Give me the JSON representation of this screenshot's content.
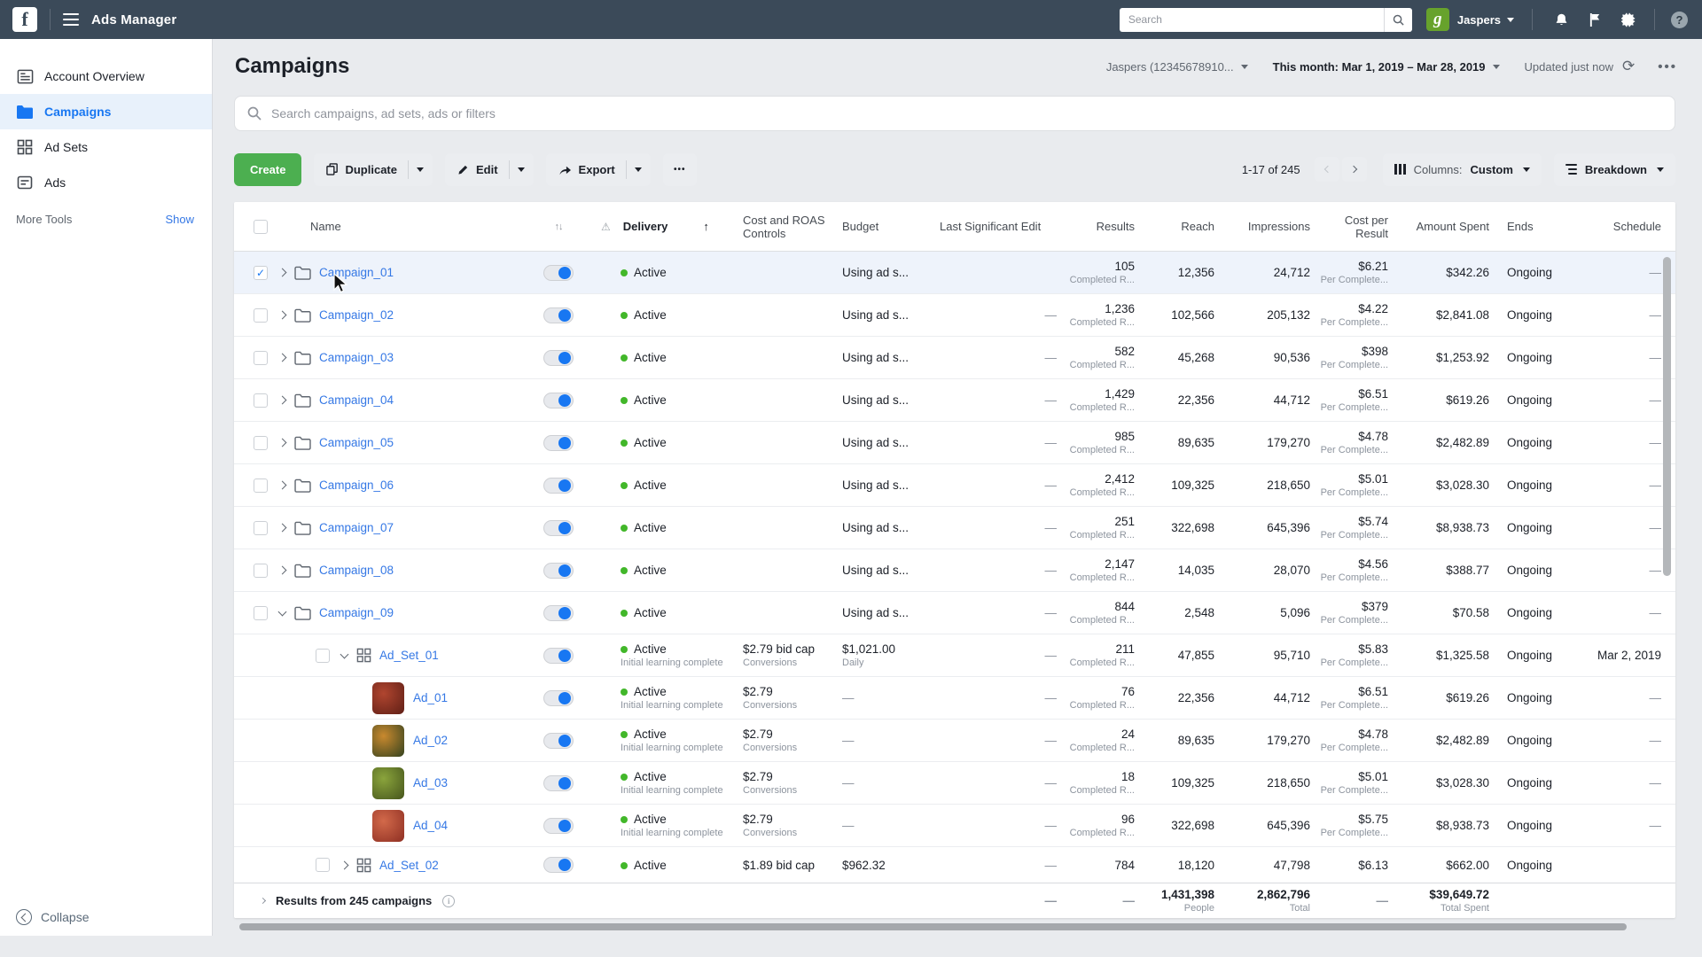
{
  "colors": {
    "topbar_bg": "#3b4a59",
    "accent_blue": "#1877f2",
    "link_blue": "#3578e5",
    "active_green": "#42b72a",
    "create_green": "#4caf50",
    "selected_row": "#eef3fb",
    "avatar_green": "#67a22c"
  },
  "topbar": {
    "logo_letter": "f",
    "title": "Ads Manager",
    "search_placeholder": "Search",
    "avatar_letter": "g",
    "user": "Jaspers",
    "help": "?"
  },
  "sidebar": {
    "items": [
      {
        "label": "Account Overview",
        "icon": "account-overview-icon",
        "selected": false
      },
      {
        "label": "Campaigns",
        "icon": "campaigns-folder-icon",
        "selected": true
      },
      {
        "label": "Ad Sets",
        "icon": "ad-sets-grid-icon",
        "selected": false
      },
      {
        "label": "Ads",
        "icon": "ads-icon",
        "selected": false
      }
    ],
    "more_tools": "More Tools",
    "show": "Show",
    "collapse": "Collapse"
  },
  "header": {
    "title": "Campaigns",
    "account": "Jaspers (12345678910...",
    "date_range": "This month: Mar 1, 2019 – Mar 28, 2019",
    "updated": "Updated just now",
    "refresh_icon": "⟳",
    "more": "•••"
  },
  "search": {
    "placeholder": "Search campaigns, ad sets, ads or filters"
  },
  "toolbar": {
    "create": "Create",
    "duplicate": "Duplicate",
    "edit": "Edit",
    "export": "Export",
    "more": "•••",
    "range": "1-17 of 245",
    "columns_prefix": "Columns:",
    "columns_value": "Custom",
    "breakdown": "Breakdown"
  },
  "table": {
    "columns": {
      "name": "Name",
      "sort": "↑↓",
      "warn": "⚠",
      "delivery": "Delivery",
      "delivery_sort": "↑",
      "cost_roas": "Cost and ROAS Controls",
      "budget": "Budget",
      "last_edit": "Last Significant Edit",
      "results": "Results",
      "reach": "Reach",
      "impressions": "Impressions",
      "cpr": "Cost per Result",
      "spent": "Amount Spent",
      "ends": "Ends",
      "schedule": "Schedule"
    },
    "rows": [
      {
        "type": "campaign",
        "name": "Campaign_01",
        "chevron": "right",
        "checked": true,
        "selected": true,
        "delivery": "Active",
        "delivery_sub": "",
        "cost_roas": "",
        "cost_roas_sub": "",
        "budget": "Using ad s...",
        "budget_sub": "",
        "last_edit": "",
        "results": "105",
        "results_sub": "Completed R...",
        "reach": "12,356",
        "impressions": "24,712",
        "cpr": "$6.21",
        "cpr_sub": "Per Complete...",
        "spent": "$342.26",
        "ends": "Ongoing",
        "schedule": "—"
      },
      {
        "type": "campaign",
        "name": "Campaign_02",
        "chevron": "right",
        "checked": false,
        "selected": false,
        "delivery": "Active",
        "delivery_sub": "",
        "cost_roas": "",
        "cost_roas_sub": "",
        "budget": "Using ad s...",
        "budget_sub": "",
        "last_edit": "—",
        "results": "1,236",
        "results_sub": "Completed R...",
        "reach": "102,566",
        "impressions": "205,132",
        "cpr": "$4.22",
        "cpr_sub": "Per Complete...",
        "spent": "$2,841.08",
        "ends": "Ongoing",
        "schedule": "—"
      },
      {
        "type": "campaign",
        "name": "Campaign_03",
        "chevron": "right",
        "checked": false,
        "selected": false,
        "delivery": "Active",
        "delivery_sub": "",
        "cost_roas": "",
        "cost_roas_sub": "",
        "budget": "Using ad s...",
        "budget_sub": "",
        "last_edit": "—",
        "results": "582",
        "results_sub": "Completed R...",
        "reach": "45,268",
        "impressions": "90,536",
        "cpr": "$398",
        "cpr_sub": "Per Complete...",
        "spent": "$1,253.92",
        "ends": "Ongoing",
        "schedule": "—"
      },
      {
        "type": "campaign",
        "name": "Campaign_04",
        "chevron": "right",
        "checked": false,
        "selected": false,
        "delivery": "Active",
        "delivery_sub": "",
        "cost_roas": "",
        "cost_roas_sub": "",
        "budget": "Using ad s...",
        "budget_sub": "",
        "last_edit": "—",
        "results": "1,429",
        "results_sub": "Completed R...",
        "reach": "22,356",
        "impressions": "44,712",
        "cpr": "$6.51",
        "cpr_sub": "Per Complete...",
        "spent": "$619.26",
        "ends": "Ongoing",
        "schedule": "—"
      },
      {
        "type": "campaign",
        "name": "Campaign_05",
        "chevron": "right",
        "checked": false,
        "selected": false,
        "delivery": "Active",
        "delivery_sub": "",
        "cost_roas": "",
        "cost_roas_sub": "",
        "budget": "Using ad s...",
        "budget_sub": "",
        "last_edit": "—",
        "results": "985",
        "results_sub": "Completed R...",
        "reach": "89,635",
        "impressions": "179,270",
        "cpr": "$4.78",
        "cpr_sub": "Per Complete...",
        "spent": "$2,482.89",
        "ends": "Ongoing",
        "schedule": "—"
      },
      {
        "type": "campaign",
        "name": "Campaign_06",
        "chevron": "right",
        "checked": false,
        "selected": false,
        "delivery": "Active",
        "delivery_sub": "",
        "cost_roas": "",
        "cost_roas_sub": "",
        "budget": "Using ad s...",
        "budget_sub": "",
        "last_edit": "—",
        "results": "2,412",
        "results_sub": "Completed R...",
        "reach": "109,325",
        "impressions": "218,650",
        "cpr": "$5.01",
        "cpr_sub": "Per Complete...",
        "spent": "$3,028.30",
        "ends": "Ongoing",
        "schedule": "—"
      },
      {
        "type": "campaign",
        "name": "Campaign_07",
        "chevron": "right",
        "checked": false,
        "selected": false,
        "delivery": "Active",
        "delivery_sub": "",
        "cost_roas": "",
        "cost_roas_sub": "",
        "budget": "Using ad s...",
        "budget_sub": "",
        "last_edit": "—",
        "results": "251",
        "results_sub": "Completed R...",
        "reach": "322,698",
        "impressions": "645,396",
        "cpr": "$5.74",
        "cpr_sub": "Per Complete...",
        "spent": "$8,938.73",
        "ends": "Ongoing",
        "schedule": "—"
      },
      {
        "type": "campaign",
        "name": "Campaign_08",
        "chevron": "right",
        "checked": false,
        "selected": false,
        "delivery": "Active",
        "delivery_sub": "",
        "cost_roas": "",
        "cost_roas_sub": "",
        "budget": "Using ad s...",
        "budget_sub": "",
        "last_edit": "—",
        "results": "2,147",
        "results_sub": "Completed R...",
        "reach": "14,035",
        "impressions": "28,070",
        "cpr": "$4.56",
        "cpr_sub": "Per Complete...",
        "spent": "$388.77",
        "ends": "Ongoing",
        "schedule": "—"
      },
      {
        "type": "campaign",
        "name": "Campaign_09",
        "chevron": "down",
        "checked": false,
        "selected": false,
        "delivery": "Active",
        "delivery_sub": "",
        "cost_roas": "",
        "cost_roas_sub": "",
        "budget": "Using ad s...",
        "budget_sub": "",
        "last_edit": "—",
        "results": "844",
        "results_sub": "Completed R...",
        "reach": "2,548",
        "impressions": "5,096",
        "cpr": "$379",
        "cpr_sub": "Per Complete...",
        "spent": "$70.58",
        "ends": "Ongoing",
        "schedule": "—"
      },
      {
        "type": "adset",
        "name": "Ad_Set_01",
        "chevron": "down",
        "checked": false,
        "selected": false,
        "delivery": "Active",
        "delivery_sub": "Initial learning complete",
        "cost_roas": "$2.79 bid cap",
        "cost_roas_sub": "Conversions",
        "budget": "$1,021.00",
        "budget_sub": "Daily",
        "last_edit": "—",
        "results": "211",
        "results_sub": "Completed R...",
        "reach": "47,855",
        "impressions": "95,710",
        "cpr": "$5.83",
        "cpr_sub": "Per Complete...",
        "spent": "$1,325.58",
        "ends": "Ongoing",
        "schedule": "Mar 2, 2019"
      },
      {
        "type": "ad",
        "name": "Ad_01",
        "thumb": [
          "#b0452f",
          "#5f1f16"
        ],
        "delivery": "Active",
        "delivery_sub": "Initial learning complete",
        "cost_roas": "$2.79",
        "cost_roas_sub": "Conversions",
        "budget": "—",
        "budget_sub": "",
        "last_edit": "—",
        "results": "76",
        "results_sub": "Completed R...",
        "reach": "22,356",
        "impressions": "44,712",
        "cpr": "$6.51",
        "cpr_sub": "Per Complete...",
        "spent": "$619.26",
        "ends": "Ongoing",
        "schedule": "—"
      },
      {
        "type": "ad",
        "name": "Ad_02",
        "thumb": [
          "#c9892e",
          "#33421f"
        ],
        "delivery": "Active",
        "delivery_sub": "Initial learning complete",
        "cost_roas": "$2.79",
        "cost_roas_sub": "Conversions",
        "budget": "—",
        "budget_sub": "",
        "last_edit": "—",
        "results": "24",
        "results_sub": "Completed R...",
        "reach": "89,635",
        "impressions": "179,270",
        "cpr": "$4.78",
        "cpr_sub": "Per Complete...",
        "spent": "$2,482.89",
        "ends": "Ongoing",
        "schedule": "—"
      },
      {
        "type": "ad",
        "name": "Ad_03",
        "thumb": [
          "#8aa43c",
          "#46551c"
        ],
        "delivery": "Active",
        "delivery_sub": "Initial learning complete",
        "cost_roas": "$2.79",
        "cost_roas_sub": "Conversions",
        "budget": "—",
        "budget_sub": "",
        "last_edit": "—",
        "results": "18",
        "results_sub": "Completed R...",
        "reach": "109,325",
        "impressions": "218,650",
        "cpr": "$5.01",
        "cpr_sub": "Per Complete...",
        "spent": "$3,028.30",
        "ends": "Ongoing",
        "schedule": "—"
      },
      {
        "type": "ad",
        "name": "Ad_04",
        "thumb": [
          "#d2694a",
          "#8e2f23"
        ],
        "delivery": "Active",
        "delivery_sub": "Initial learning complete",
        "cost_roas": "$2.79",
        "cost_roas_sub": "Conversions",
        "budget": "—",
        "budget_sub": "",
        "last_edit": "—",
        "results": "96",
        "results_sub": "Completed R...",
        "reach": "322,698",
        "impressions": "645,396",
        "cpr": "$5.75",
        "cpr_sub": "Per Complete...",
        "spent": "$8,938.73",
        "ends": "Ongoing",
        "schedule": "—"
      },
      {
        "type": "adset",
        "name": "Ad_Set_02",
        "chevron": "right",
        "checked": false,
        "selected": false,
        "clipped": true,
        "delivery": "Active",
        "delivery_sub": "",
        "cost_roas": "$1.89 bid cap",
        "cost_roas_sub": "",
        "budget": "$962.32",
        "budget_sub": "",
        "last_edit": "—",
        "results": "784",
        "results_sub": "",
        "reach": "18,120",
        "impressions": "47,798",
        "cpr": "$6.13",
        "cpr_sub": "",
        "spent": "$662.00",
        "ends": "Ongoing",
        "schedule": ""
      }
    ],
    "footer": {
      "label": "Results from 245 campaigns",
      "last_edit": "—",
      "results": "—",
      "reach": "1,431,398",
      "reach_sub": "People",
      "impressions": "2,862,796",
      "impressions_sub": "Total",
      "cpr": "—",
      "spent": "$39,649.72",
      "spent_sub": "Total Spent"
    }
  }
}
